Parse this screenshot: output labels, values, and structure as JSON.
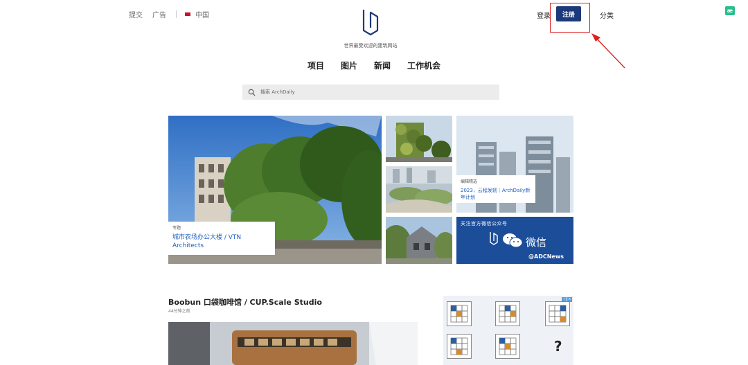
{
  "topbar": {
    "submit": "提交",
    "ads": "广告",
    "region": "中国",
    "login": "登录",
    "register": "注册",
    "categories": "分类"
  },
  "site": {
    "tagline": "世界最受欢迎的建筑网站"
  },
  "nav": [
    {
      "label": "项目"
    },
    {
      "label": "图片"
    },
    {
      "label": "新闻"
    },
    {
      "label": "工作机会"
    }
  ],
  "search": {
    "placeholder": "搜索 ArchDaily"
  },
  "hero": {
    "main": {
      "tag": "专题",
      "title": "城市农场办公大楼 / VTN Architects"
    },
    "editor": {
      "tag": "编辑精选",
      "title": "2023，云程发轫｜ArchDaily新年计划"
    },
    "wechat": {
      "heading": "关注官方微信公众号",
      "word": "微信",
      "handle": "@ADCNews"
    }
  },
  "article": {
    "title": "Boobun 口袋咖啡馆 / CUP.Scale Studio",
    "time": "44分钟之前"
  },
  "extension": {
    "label": "æ"
  },
  "colors": {
    "brand": "#1c3a7a",
    "annotation": "#e02020",
    "link": "#1d5ebd"
  }
}
